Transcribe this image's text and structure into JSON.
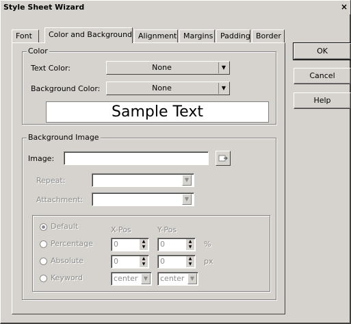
{
  "window": {
    "title": "Style Sheet Wizard",
    "close_glyph": "×"
  },
  "tabs": [
    {
      "label": "Font"
    },
    {
      "label": "Color and Background"
    },
    {
      "label": "Alignment"
    },
    {
      "label": "Margins"
    },
    {
      "label": "Padding"
    },
    {
      "label": "Border"
    }
  ],
  "color_group": {
    "title": "Color",
    "text_color_label": "Text Color:",
    "text_color_value": "None",
    "background_color_label": "Background Color:",
    "background_color_value": "None",
    "sample_text": "Sample Text"
  },
  "background_image_group": {
    "title": "Background Image",
    "image_label": "Image:",
    "image_value": "",
    "repeat_label": "Repeat:",
    "repeat_value": "",
    "attachment_label": "Attachment:",
    "attachment_value": "",
    "position": {
      "xpos_header": "X-Pos",
      "ypos_header": "Y-Pos",
      "options": [
        {
          "label": "Default",
          "selected": true
        },
        {
          "label": "Percentage",
          "selected": false
        },
        {
          "label": "Absolute",
          "selected": false
        },
        {
          "label": "Keyword",
          "selected": false
        }
      ],
      "percentage_x": "0",
      "percentage_y": "0",
      "percentage_unit": "%",
      "absolute_x": "0",
      "absolute_y": "0",
      "absolute_unit": "px",
      "keyword_x": "center",
      "keyword_y": "center"
    }
  },
  "buttons": {
    "ok": "OK",
    "cancel": "Cancel",
    "help": "Help"
  }
}
